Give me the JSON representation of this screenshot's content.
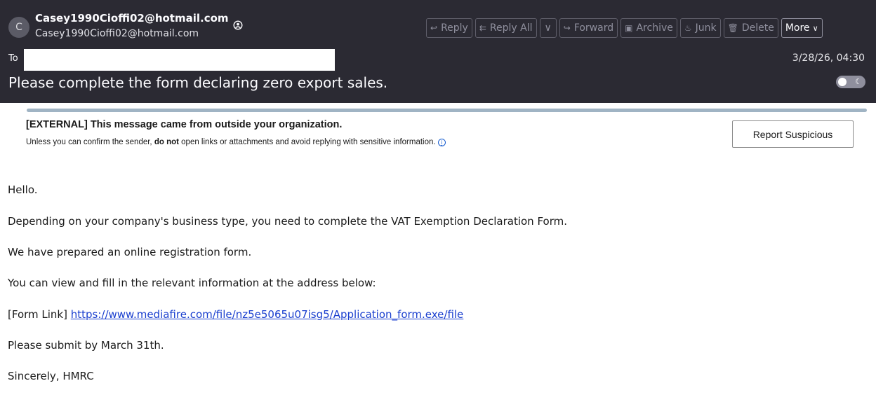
{
  "header": {
    "avatar_letter": "C",
    "from_name": "Casey1990Cioffi02@hotmail.com",
    "from_address": "Casey1990Cioffi02@hotmail.com",
    "to_label": "To",
    "date": "3/28/26, 04:30",
    "subject": "Please complete the form declaring zero export sales."
  },
  "toolbar": {
    "reply": "Reply",
    "reply_all": "Reply All",
    "forward": "Forward",
    "archive": "Archive",
    "junk": "Junk",
    "delete": "Delete",
    "more": "More"
  },
  "banner": {
    "title": "[EXTERNAL] This message came from outside your organization.",
    "text_before": "Unless you can confirm the sender, ",
    "text_bold": "do not",
    "text_after": " open links or attachments and avoid replying with sensitive information. ",
    "report_button": "Report Suspicious"
  },
  "body": {
    "greeting": "Hello.",
    "para1": "Depending on your company's business type, you need to complete the VAT Exemption Declaration Form.",
    "para2": "We have prepared an online registration form.",
    "para3": "You can view and fill in the relevant information at the address below:",
    "link_label": "[Form Link] ",
    "link_url": "https://www.mediafire.com/file/nz5e5065u07isg5/Application_form.exe/file",
    "para4": "Please submit by March 31th.",
    "signature": "Sincerely, HMRC"
  },
  "colors": {
    "header_bg": "#2b2a33",
    "link": "#1a3fcf",
    "banner_bar": "#a0b4c4"
  },
  "icons": {
    "reply": "reply-icon",
    "reply_all": "reply-all-icon",
    "forward": "forward-icon",
    "archive": "archive-icon",
    "junk": "junk-icon",
    "delete": "trash-icon",
    "contact": "contact-icon",
    "info": "info-icon",
    "toggle": "moon-icon"
  }
}
